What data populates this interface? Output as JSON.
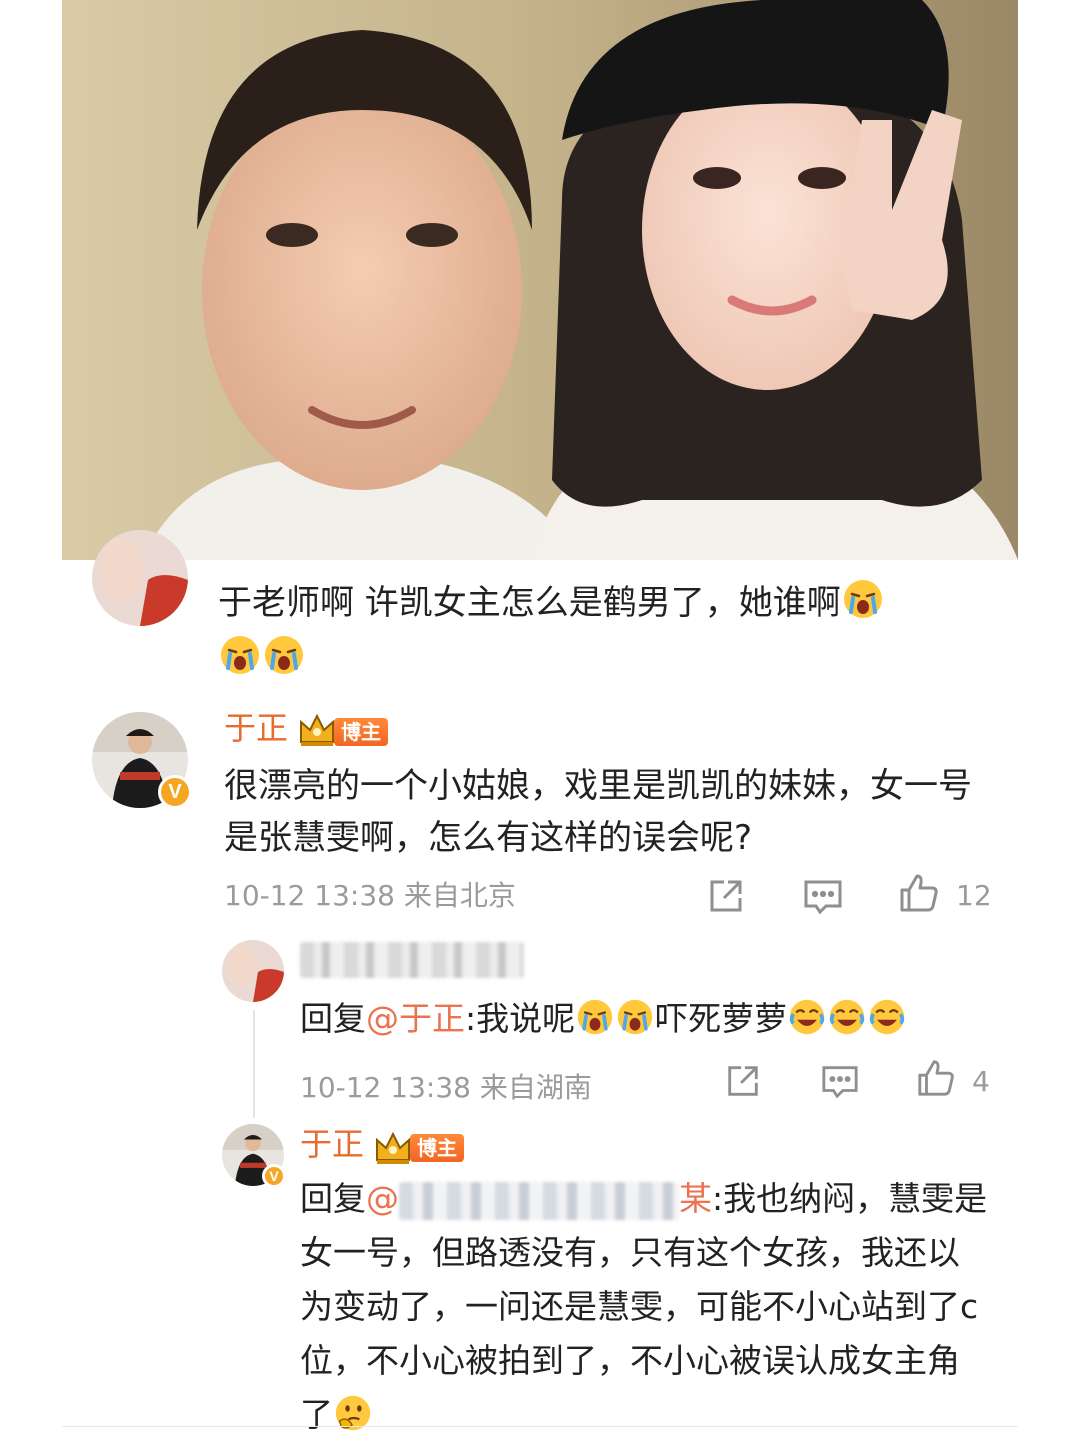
{
  "comment_1": {
    "text": "于老师啊 许凯女主怎么是鹤男了，她谁啊",
    "emojis": [
      "crying-emoji",
      "crying-emoji",
      "crying-emoji"
    ]
  },
  "comment_2": {
    "username": "于正",
    "badge": "博主",
    "text": "很漂亮的一个小姑娘，戏里是凯凯的妹妹，女一号是张慧雯啊，怎么有这样的误会呢?",
    "time": "10-12 13:38",
    "location": "来自北京",
    "like_count": "12"
  },
  "reply_1": {
    "prefix": "回复",
    "mention": "@于正",
    "text_a": ":我说呢",
    "text_b": "吓死萝萝",
    "time": "10-12 13:38",
    "location": "来自湖南",
    "like_count": "4"
  },
  "reply_2": {
    "username": "于正",
    "badge": "博主",
    "prefix": "回复",
    "mention_start": "@",
    "mention_end": "某",
    "text": ":我也纳闷，慧雯是女一号，但路透没有，只有这个女孩，我还以为变动了，一问还是慧雯，可能不小心站到了c位，不小心被拍到了，不小心被误认成女主角了"
  },
  "icons": [
    "share-icon",
    "comment-icon",
    "like-icon",
    "crown-icon",
    "verified-icon"
  ],
  "colors": {
    "username": "#e86b2e",
    "badge": "#f26522",
    "meta": "#9b9b9b",
    "mention": "#eb7350"
  }
}
